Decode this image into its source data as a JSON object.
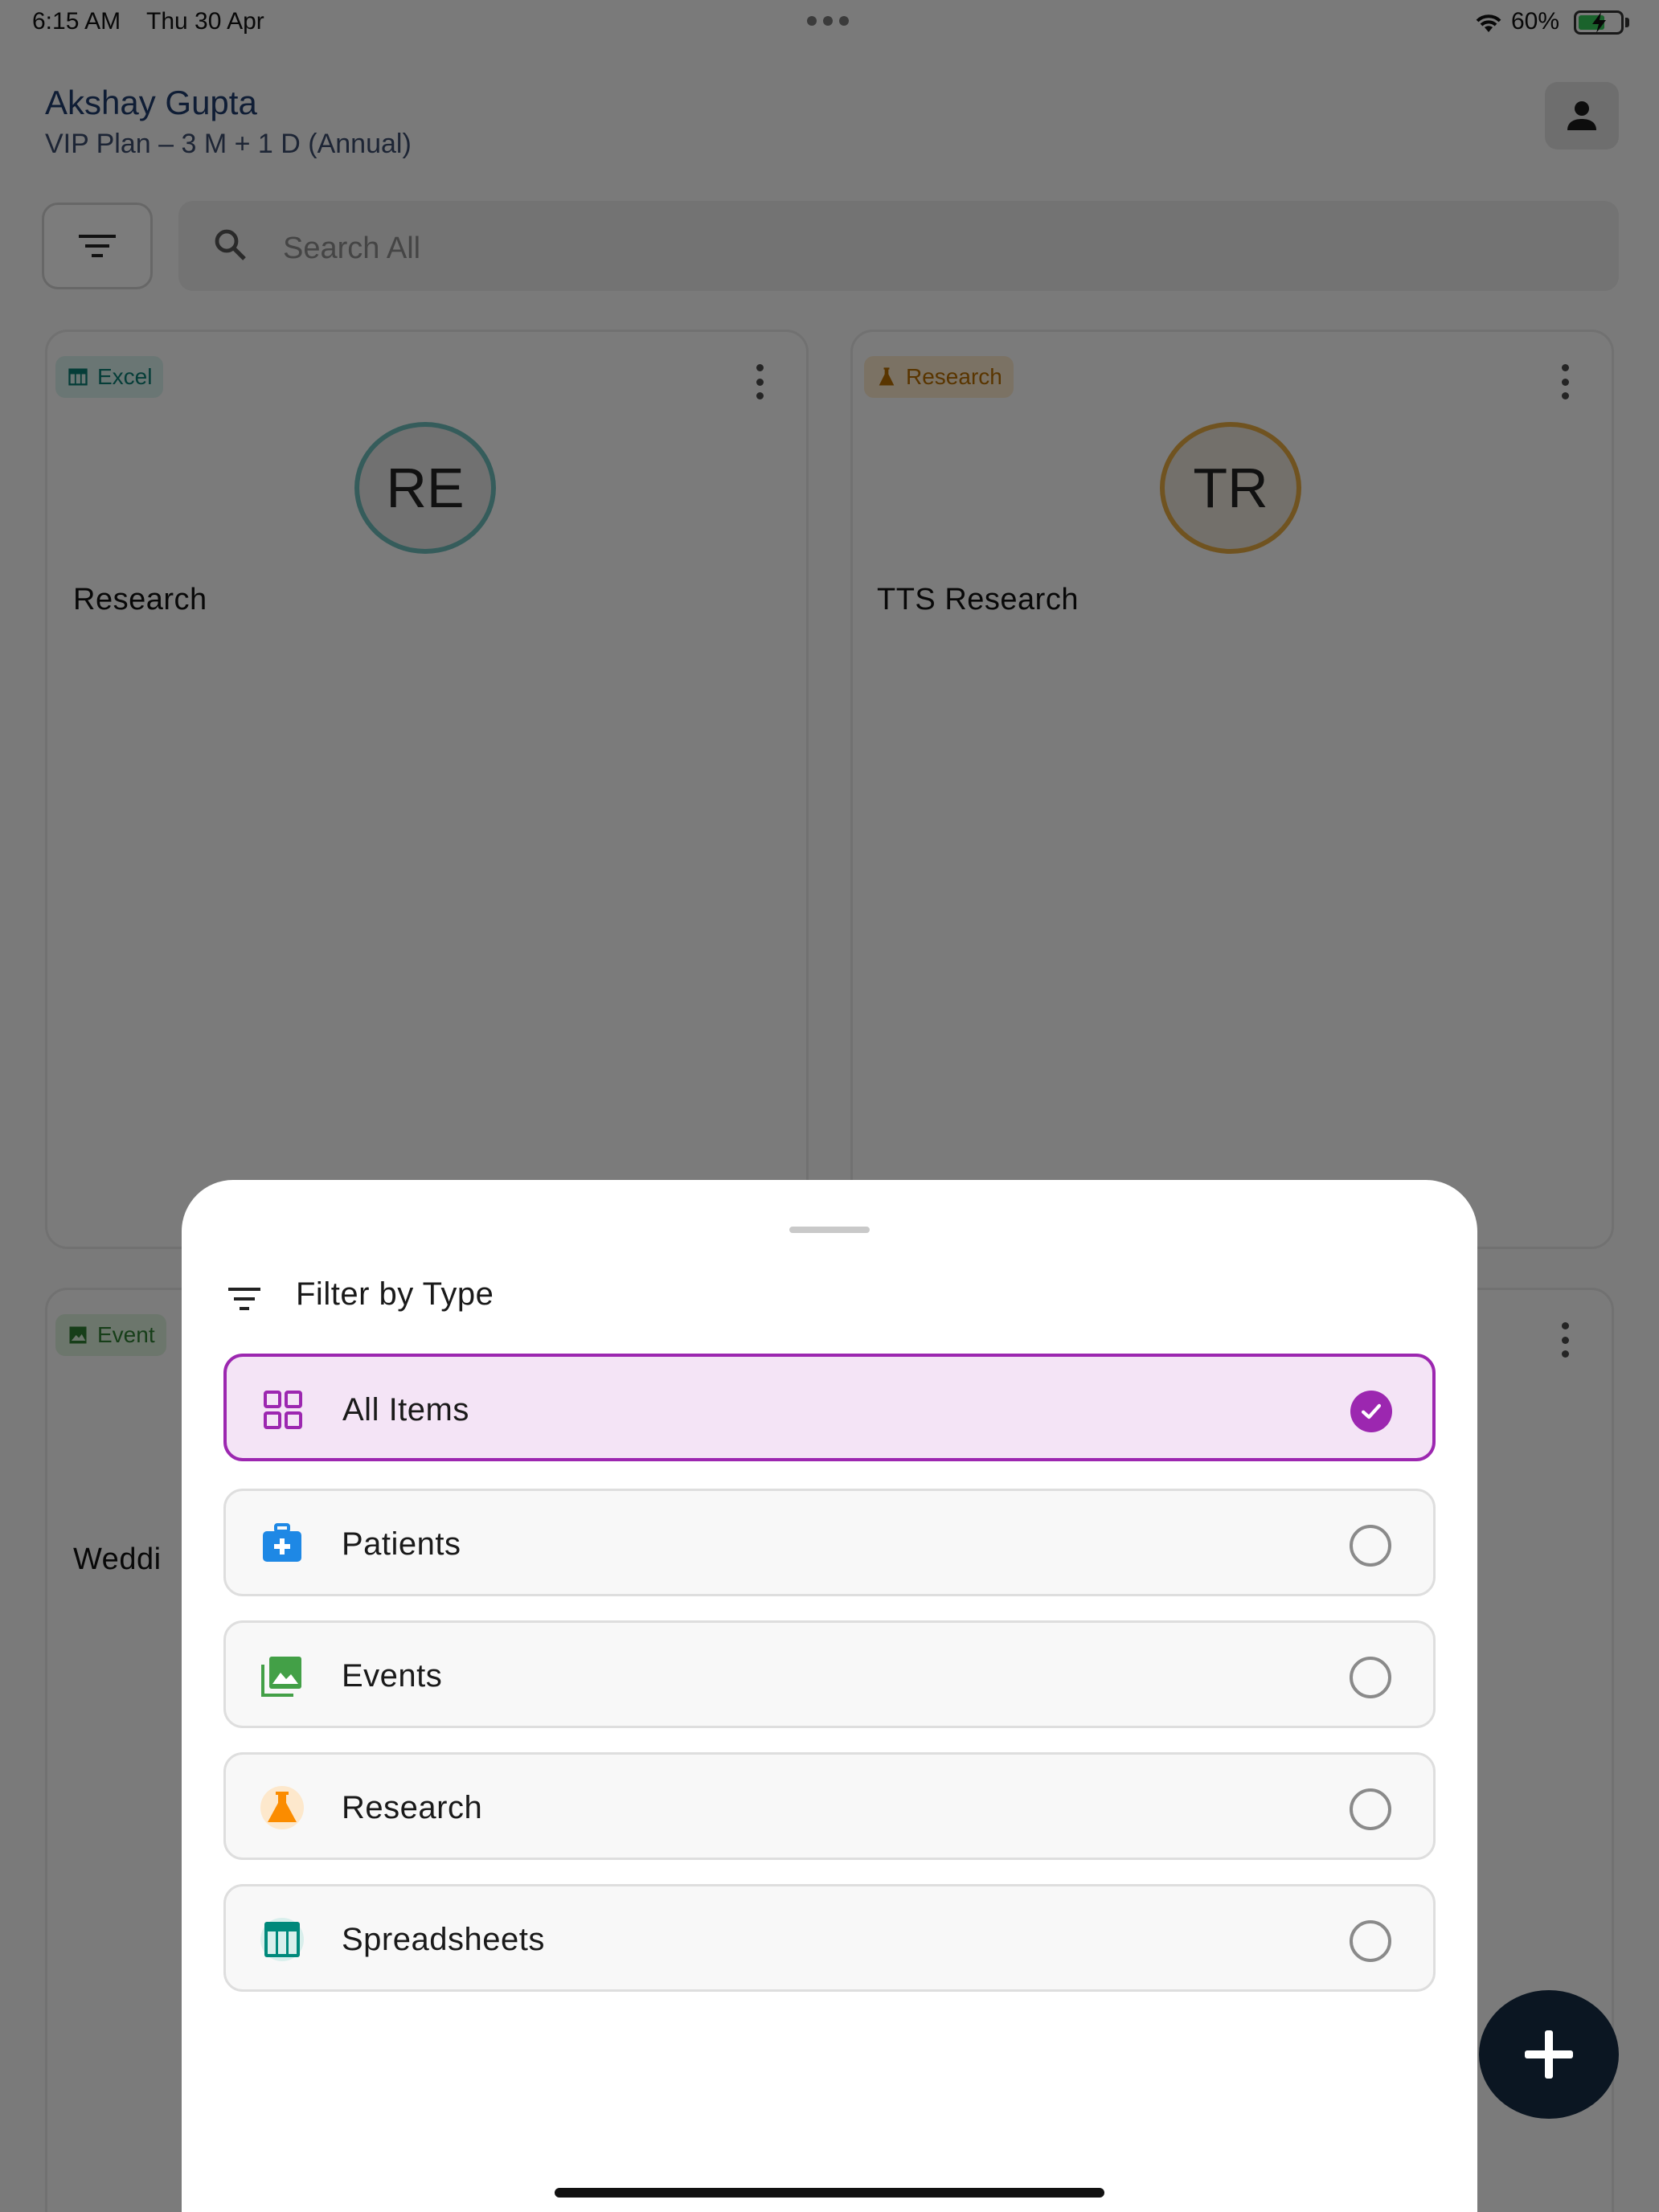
{
  "status_bar": {
    "time": "6:15 AM",
    "date": "Thu 30 Apr",
    "battery": "60%"
  },
  "header": {
    "user_name": "Akshay Gupta",
    "plan": "VIP Plan – 3 M + 1 D (Annual)"
  },
  "search": {
    "placeholder": "Search All"
  },
  "cards": [
    {
      "tag": "Excel",
      "initials": "RE",
      "title": "Research",
      "tag_color": "#0a7a70",
      "ring_color": "#55a8a6"
    },
    {
      "tag": "Research",
      "initials": "TR",
      "title": "TTS Research",
      "tag_color": "#b36b00",
      "ring_color": "#c98a2a"
    },
    {
      "tag": "Event",
      "title": "Weddi",
      "tag_color": "#2e7d32"
    }
  ],
  "sheet": {
    "title": "Filter by Type",
    "options": [
      {
        "label": "All Items",
        "icon": "grid-icon",
        "selected": true
      },
      {
        "label": "Patients",
        "icon": "medical-bag-icon",
        "selected": false
      },
      {
        "label": "Events",
        "icon": "photo-library-icon",
        "selected": false
      },
      {
        "label": "Research",
        "icon": "flask-icon",
        "selected": false
      },
      {
        "label": "Spreadsheets",
        "icon": "table-icon",
        "selected": false
      }
    ]
  },
  "colors": {
    "accent": "#9c27b0",
    "selected_bg": "#f4e4f6",
    "fab": "#0b1622"
  }
}
